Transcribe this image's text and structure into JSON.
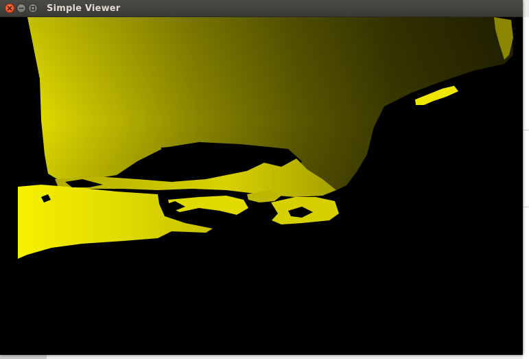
{
  "window": {
    "title": "Simple Viewer",
    "controls": {
      "close": "close-icon",
      "minimize": "minimize-icon",
      "maximize": "maximize-icon"
    }
  },
  "viewer": {
    "content": "depth-image",
    "colors": {
      "background": "#000000",
      "bright": "#f0ec00",
      "dim": "#5a5700"
    }
  }
}
